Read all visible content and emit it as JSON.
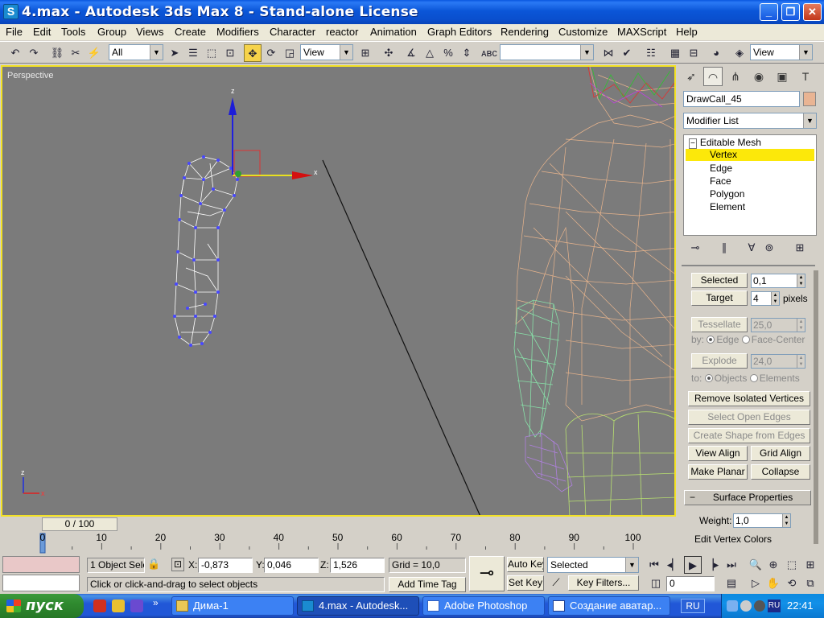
{
  "window": {
    "title": "4.max - Autodesk 3ds Max 8  - Stand-alone License",
    "app_icon": "S"
  },
  "menu": [
    "File",
    "Edit",
    "Tools",
    "Group",
    "Views",
    "Create",
    "Modifiers",
    "Character",
    "reactor",
    "Animation",
    "Graph Editors",
    "Rendering",
    "Customize",
    "MAXScript",
    "Help"
  ],
  "toolbar": {
    "selection_filter": "All",
    "ref_coord": "View",
    "named_selection": "",
    "view_combo": "View"
  },
  "viewport": {
    "label": "Perspective",
    "gizmo_axes": {
      "x": "x",
      "z": "z",
      "y": "y"
    }
  },
  "command_panel": {
    "object_name": "DrawCall_45",
    "modifier_list": "Modifier List",
    "stack": [
      "Editable Mesh",
      "Vertex",
      "Edge",
      "Face",
      "Polygon",
      "Element"
    ],
    "selected_level": "Vertex",
    "selected_label": "Selected",
    "selected_value": "0,1",
    "target_label": "Target",
    "target_value": "4",
    "pixels_label": "pixels",
    "tessellate_label": "Tessellate",
    "tessellate_value": "25,0",
    "by_label": "by:",
    "edge_label": "Edge",
    "face_center_label": "Face-Center",
    "explode_label": "Explode",
    "explode_value": "24,0",
    "to_label": "to:",
    "objects_label": "Objects",
    "elements_label": "Elements",
    "remove_isolated": "Remove Isolated Vertices",
    "select_open_edges": "Select Open Edges",
    "create_shape": "Create Shape from Edges",
    "view_align": "View Align",
    "grid_align": "Grid Align",
    "make_planar": "Make Planar",
    "collapse": "Collapse",
    "surface_properties": "Surface Properties",
    "weight_label": "Weight:",
    "weight_value": "1,0",
    "edit_vertex_colors": "Edit Vertex Colors"
  },
  "timeline": {
    "slider": "0 / 100",
    "ticks": [
      "0",
      "10",
      "20",
      "30",
      "40",
      "50",
      "60",
      "70",
      "80",
      "90",
      "100"
    ]
  },
  "status": {
    "selection": "1 Object Sele",
    "x_label": "X:",
    "x_value": "-0,873",
    "y_label": "Y:",
    "y_value": "0,046",
    "z_label": "Z:",
    "z_value": "1,526",
    "grid": "Grid = 10,0",
    "prompt": "Click or click-and-drag to select objects",
    "add_time_tag": "Add Time Tag",
    "auto_key": "Auto Key",
    "set_key": "Set Key",
    "key_mode": "Selected",
    "key_filters": "Key Filters...",
    "frame": "0"
  },
  "taskbar": {
    "start": "пуск",
    "tasks": [
      "Дима-1",
      "4.max - Autodesk...",
      "Adobe Photoshop",
      "Создание аватар..."
    ],
    "active_task": "4.max - Autodesk...",
    "lang": "RU",
    "clock": "22:41"
  }
}
